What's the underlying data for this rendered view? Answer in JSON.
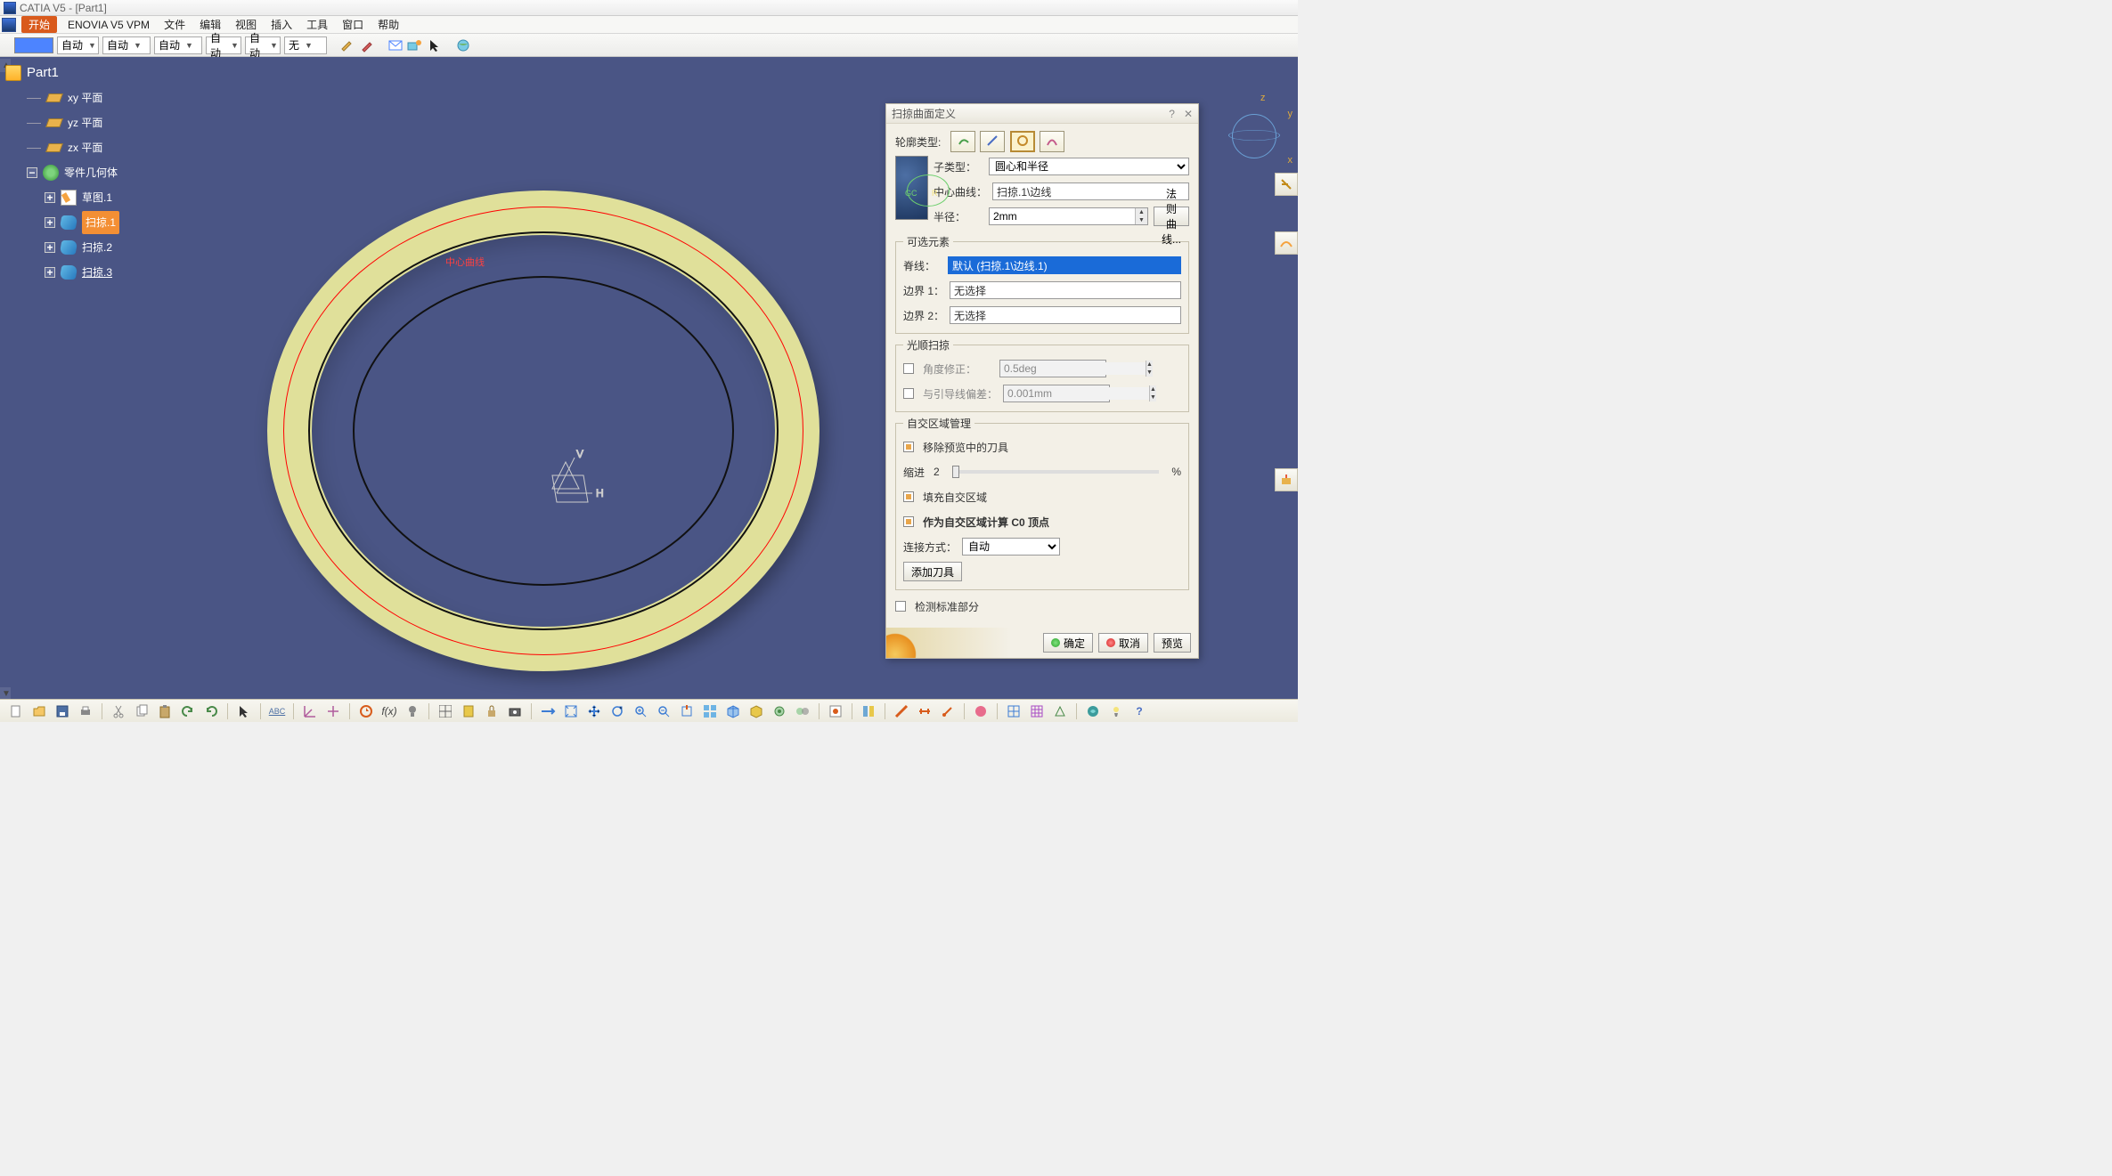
{
  "title": "CATIA V5 - [Part1]",
  "menubar": {
    "start": "开始",
    "items": [
      "ENOVIA V5 VPM",
      "文件",
      "编辑",
      "视图",
      "插入",
      "工具",
      "窗口",
      "帮助"
    ]
  },
  "toolbar": {
    "dd1": "自动",
    "dd2": "自动",
    "dd3": "自动",
    "dd4": "自动",
    "dd5": "自动",
    "dd6": "无"
  },
  "tree": {
    "root": "Part1",
    "planes": [
      "xy 平面",
      "yz 平面",
      "zx 平面"
    ],
    "body": "零件几何体",
    "children": [
      {
        "label": "草图.1",
        "type": "sketch"
      },
      {
        "label": "扫掠.1",
        "type": "sweep",
        "selected": true
      },
      {
        "label": "扫掠.2",
        "type": "sweep"
      },
      {
        "label": "扫掠.3",
        "type": "sweep",
        "underline": true
      }
    ]
  },
  "viewport": {
    "redlabel": "中心曲线",
    "hv": {
      "h": "H",
      "v": "V"
    }
  },
  "compass": {
    "x": "x",
    "y": "y",
    "z": "z"
  },
  "dialog": {
    "title": "扫掠曲面定义",
    "profile_type_lbl": "轮廓类型:",
    "subtype_lbl": "子类型：",
    "subtype_value": "圆心和半径",
    "center_curve_lbl": "中心曲线：",
    "center_curve_value": "扫掠.1\\边线",
    "radius_lbl": "半径：",
    "radius_value": "2mm",
    "law_btn": "法则曲线...",
    "opt_group": "可选元素",
    "spine_lbl": "脊线：",
    "spine_value": "默认 (扫掠.1\\边线.1)",
    "bound1_lbl": "边界 1：",
    "bound1_value": "无选择",
    "bound2_lbl": "边界 2：",
    "bound2_value": "无选择",
    "smooth_group": "光顺扫掠",
    "angle_corr_lbl": "角度修正：",
    "angle_corr_value": "0.5deg",
    "guide_dev_lbl": "与引导线偏差：",
    "guide_dev_value": "0.001mm",
    "twist_group": "自交区域管理",
    "remove_cut_lbl": "移除预览中的刀具",
    "setback_lbl": "缩进",
    "setback_value": "2",
    "setback_unit": "%",
    "fill_lbl": "填充自交区域",
    "c0_lbl": "作为自交区域计算 C0 顶点",
    "conn_lbl": "连接方式：",
    "conn_value": "自动",
    "add_cutter_btn": "添加刀具",
    "canonical_lbl": "检测标准部分",
    "ok": "确定",
    "cancel": "取消",
    "preview": "预览"
  }
}
